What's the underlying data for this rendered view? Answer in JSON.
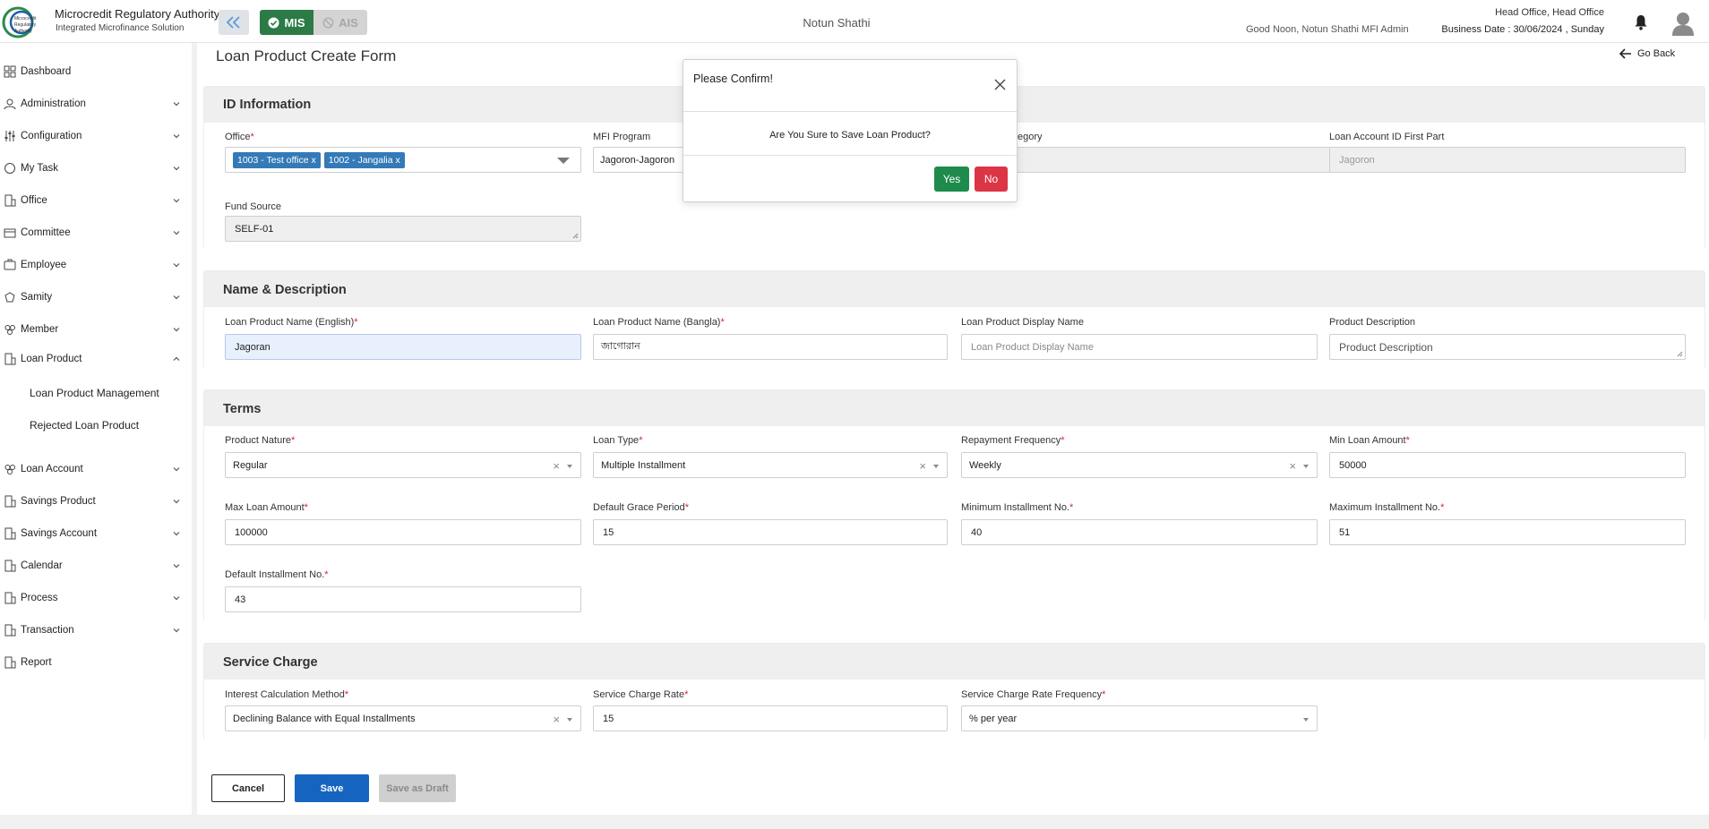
{
  "header": {
    "brand_title": "Microcredit Regulatory Authority",
    "brand_subtitle": "Integrated Microfinance Solution",
    "logo_text": "Microcredit Regulatory Authority",
    "mis_label": "MIS",
    "ais_label": "AIS",
    "center_title": "Notun Shathi",
    "greeting": "Good Noon, Notun Shathi MFI Admin",
    "office": "Head Office, Head Office",
    "business_date": "Business Date : 30/06/2024 , Sunday"
  },
  "sidebar": {
    "items": [
      {
        "label": "Dashboard",
        "icon": "dashboard-icon"
      },
      {
        "label": "Administration",
        "icon": "admin-icon"
      },
      {
        "label": "Configuration",
        "icon": "sliders-icon"
      },
      {
        "label": "My Task",
        "icon": "task-icon"
      },
      {
        "label": "Office",
        "icon": "office-icon"
      },
      {
        "label": "Committee",
        "icon": "committee-icon"
      },
      {
        "label": "Employee",
        "icon": "employee-icon"
      },
      {
        "label": "Samity",
        "icon": "samity-icon"
      },
      {
        "label": "Member",
        "icon": "member-icon"
      },
      {
        "label": "Loan Product",
        "icon": "loan-product-icon"
      },
      {
        "label": "Loan Account",
        "icon": "loan-account-icon"
      },
      {
        "label": "Savings Product",
        "icon": "savings-product-icon"
      },
      {
        "label": "Savings Account",
        "icon": "savings-account-icon"
      },
      {
        "label": "Calendar",
        "icon": "calendar-icon"
      },
      {
        "label": "Process",
        "icon": "process-icon"
      },
      {
        "label": "Transaction",
        "icon": "transaction-icon"
      },
      {
        "label": "Report",
        "icon": "report-icon"
      }
    ],
    "sub_items": [
      "Loan Product Management",
      "Rejected Loan Product"
    ]
  },
  "page": {
    "title": "Loan Product Create Form",
    "go_back": "Go Back"
  },
  "id_info": {
    "title": "ID Information",
    "office_label": "Office",
    "office_tags": [
      "1003 - Test office",
      "1002 - Jangalia"
    ],
    "tag_remove": "x",
    "mfi_program_label": "MFI Program",
    "mfi_program_value": "Jagoron-Jagoron",
    "category_label_partial": "egory",
    "loan_account_id_label": "Loan Account ID First Part",
    "loan_account_id_value": "Jagoron",
    "fund_source_label": "Fund Source",
    "fund_source_value": "SELF-01"
  },
  "name_desc": {
    "title": "Name & Description",
    "name_en_label": "Loan Product Name (English)",
    "name_en_value": "Jagoran",
    "name_bn_label": "Loan Product Name (Bangla)",
    "name_bn_value": "জাগোরান",
    "display_name_label": "Loan Product Display Name",
    "display_name_placeholder": "Loan Product Display Name",
    "description_label": "Product Description",
    "description_placeholder": "Product Description"
  },
  "terms": {
    "title": "Terms",
    "product_nature_label": "Product Nature",
    "product_nature_value": "Regular",
    "loan_type_label": "Loan Type",
    "loan_type_value": "Multiple Installment",
    "repayment_freq_label": "Repayment Frequency",
    "repayment_freq_value": "Weekly",
    "min_loan_label": "Min Loan Amount",
    "min_loan_value": "50000",
    "max_loan_label": "Max Loan Amount",
    "max_loan_value": "100000",
    "grace_label": "Default Grace Period",
    "grace_value": "15",
    "min_inst_label": "Minimum Installment No.",
    "min_inst_value": "40",
    "max_inst_label": "Maximum Installment No.",
    "max_inst_value": "51",
    "default_inst_label": "Default Installment No.",
    "default_inst_value": "43"
  },
  "service_charge": {
    "title": "Service Charge",
    "method_label": "Interest Calculation Method",
    "method_value": "Declining Balance with Equal Installments",
    "rate_label": "Service Charge Rate",
    "rate_value": "15",
    "freq_label": "Service Charge Rate Frequency",
    "freq_value": "% per year"
  },
  "actions": {
    "cancel": "Cancel",
    "save": "Save",
    "save_draft": "Save as Draft"
  },
  "modal": {
    "title": "Please Confirm!",
    "message": "Are You Sure to Save Loan Product?",
    "yes": "Yes",
    "no": "No"
  },
  "colors": {
    "primary_blue": "#1565c0",
    "mis_green": "#2c7a45",
    "yes_green": "#1e8b4c",
    "no_red": "#dc3545",
    "required_red": "#d9242b",
    "tag_blue": "#337ab7"
  }
}
